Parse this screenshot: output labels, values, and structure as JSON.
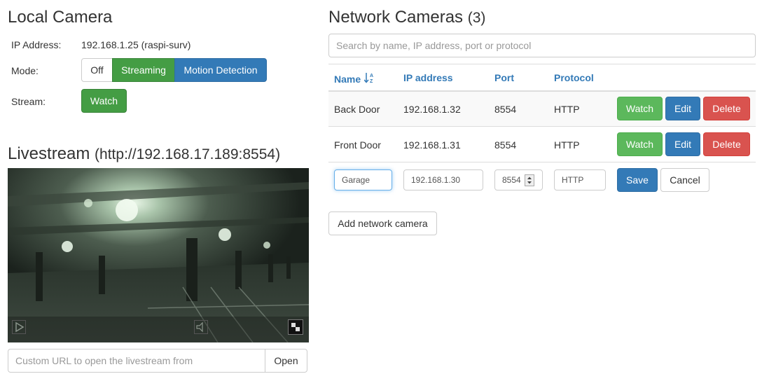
{
  "local": {
    "title": "Local Camera",
    "ip_label": "IP Address:",
    "ip_value": "192.168.1.25 (raspi-surv)",
    "mode_label": "Mode:",
    "mode_options": [
      "Off",
      "Streaming",
      "Motion Detection"
    ],
    "mode_selected": "Streaming",
    "stream_label": "Stream:",
    "watch_label": "Watch"
  },
  "livestream": {
    "title": "Livestream",
    "url": "(http://192.168.17.189:8554)",
    "custom_url_placeholder": "Custom URL to open the livestream from",
    "open_label": "Open"
  },
  "network": {
    "title": "Network Cameras",
    "count": "(3)",
    "search_placeholder": "Search by name, IP address, port or protocol",
    "columns": [
      "Name",
      "IP address",
      "Port",
      "Protocol"
    ],
    "rows": [
      {
        "name": "Back Door",
        "ip": "192.168.1.32",
        "port": "8554",
        "protocol": "HTTP"
      },
      {
        "name": "Front Door",
        "ip": "192.168.1.31",
        "port": "8554",
        "protocol": "HTTP"
      }
    ],
    "row_actions": {
      "watch": "Watch",
      "edit": "Edit",
      "delete": "Delete"
    },
    "edit_row": {
      "name": "Garage",
      "ip": "192.168.1.30",
      "port": "8554",
      "protocol": "HTTP",
      "save": "Save",
      "cancel": "Cancel"
    },
    "add_label": "Add network camera"
  },
  "colors": {
    "success": "#5cb85c",
    "primary": "#337ab7",
    "danger": "#d9534f",
    "link": "#337ab7"
  }
}
